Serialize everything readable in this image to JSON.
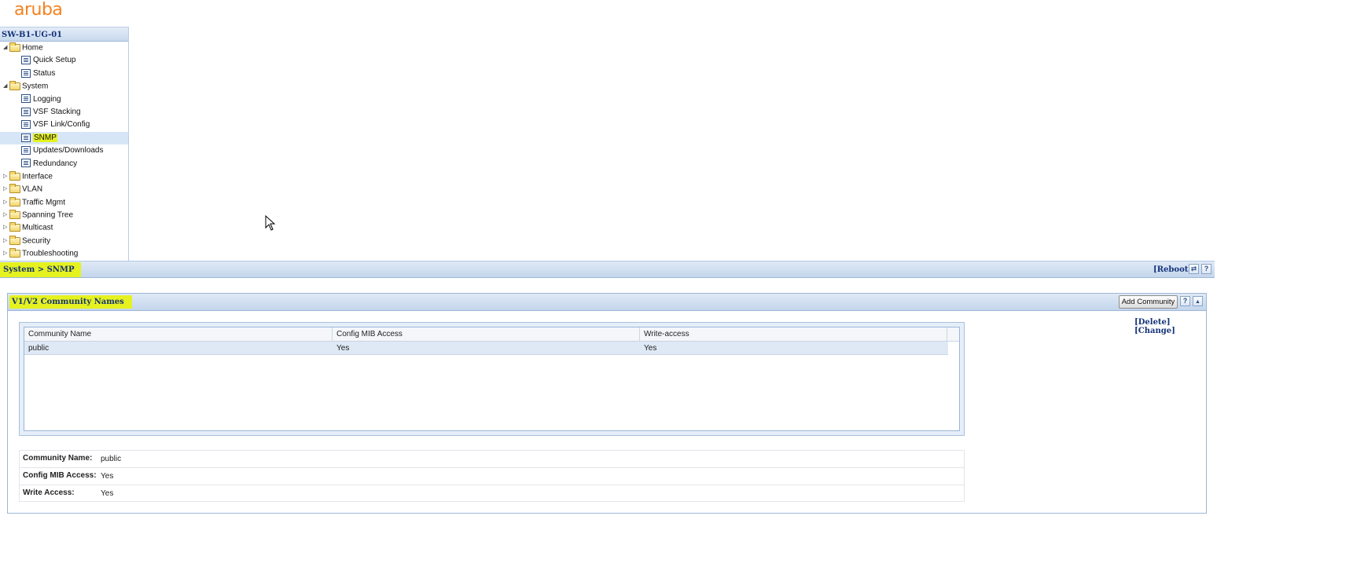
{
  "brand": {
    "logo_text": "aruba",
    "logo_color": "#f58220"
  },
  "tree": {
    "title": "SW-B1-UG-01",
    "nodes": [
      {
        "kind": "folder",
        "expanded": true,
        "label": "Home"
      },
      {
        "kind": "leaf",
        "label": "Quick Setup"
      },
      {
        "kind": "leaf",
        "label": "Status"
      },
      {
        "kind": "folder",
        "expanded": true,
        "label": "System"
      },
      {
        "kind": "leaf",
        "label": "Logging"
      },
      {
        "kind": "leaf",
        "label": "VSF Stacking"
      },
      {
        "kind": "leaf",
        "label": "VSF Link/Config"
      },
      {
        "kind": "leaf",
        "label": "SNMP",
        "selected": true
      },
      {
        "kind": "leaf",
        "label": "Updates/Downloads"
      },
      {
        "kind": "leaf",
        "label": "Redundancy"
      },
      {
        "kind": "folder",
        "expanded": false,
        "label": "Interface"
      },
      {
        "kind": "folder",
        "expanded": false,
        "label": "VLAN"
      },
      {
        "kind": "folder",
        "expanded": false,
        "label": "Traffic Mgmt"
      },
      {
        "kind": "folder",
        "expanded": false,
        "label": "Spanning Tree"
      },
      {
        "kind": "folder",
        "expanded": false,
        "label": "Multicast"
      },
      {
        "kind": "folder",
        "expanded": false,
        "label": "Security"
      },
      {
        "kind": "folder",
        "expanded": false,
        "label": "Troubleshooting"
      }
    ]
  },
  "header_bar": {
    "breadcrumb": "System > SNMP",
    "reboot_link": "[Reboot]",
    "refresh_icon": "refresh-icon",
    "help_label": "?"
  },
  "panel": {
    "title": "V1/V2 Community Names",
    "add_button": "Add Community",
    "help_label": "?",
    "collapse_icon": "chevron-up-icon",
    "delete_link": "[Delete]",
    "change_link": "[Change]",
    "grid": {
      "columns": [
        "Community Name",
        "Config MIB Access",
        "Write-access"
      ],
      "rows": [
        [
          "public",
          "Yes",
          "Yes"
        ]
      ]
    },
    "details": [
      {
        "label": "Community Name:",
        "value": "public"
      },
      {
        "label": "Config MIB Access:",
        "value": "Yes"
      },
      {
        "label": "Write Access:",
        "value": "Yes"
      }
    ]
  },
  "colors": {
    "highlight": "#e5f21f",
    "title_text": "#14337a",
    "selected_row": "#dfe9f6"
  }
}
